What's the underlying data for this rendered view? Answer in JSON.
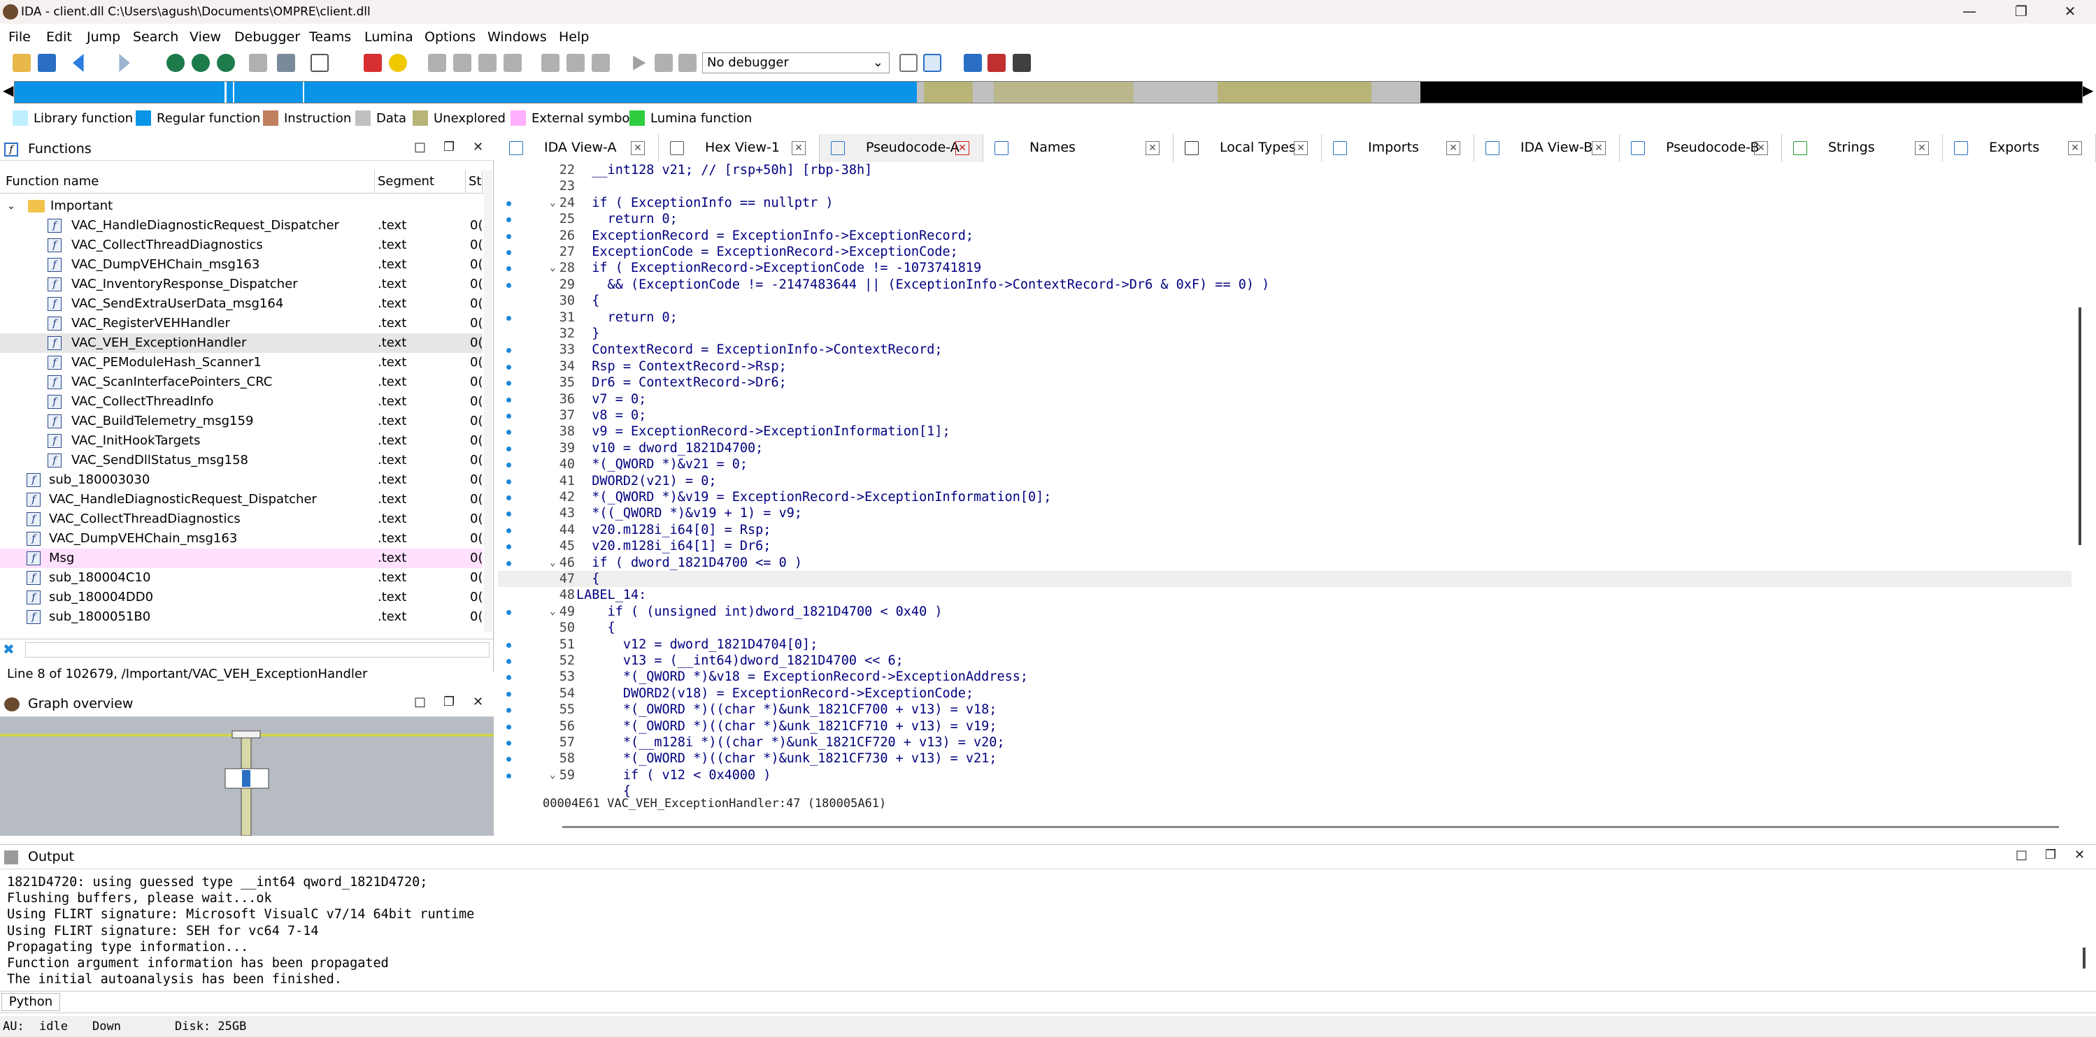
{
  "window": {
    "title": "IDA - client.dll C:\\Users\\agush\\Documents\\OMPRE\\client.dll"
  },
  "menu": [
    "File",
    "Edit",
    "Jump",
    "Search",
    "View",
    "Debugger",
    "Teams",
    "Lumina",
    "Options",
    "Windows",
    "Help"
  ],
  "toolbar": {
    "debugger_select": "No debugger"
  },
  "legend": [
    {
      "label": "Library function",
      "color": "#bfefff"
    },
    {
      "label": "Regular function",
      "color": "#0a94e8"
    },
    {
      "label": "Instruction",
      "color": "#c08060"
    },
    {
      "label": "Data",
      "color": "#c0c0c0"
    },
    {
      "label": "Unexplored",
      "color": "#b8b478"
    },
    {
      "label": "External symbol",
      "color": "#ffb0ff"
    },
    {
      "label": "Lumina function",
      "color": "#30cc40"
    }
  ],
  "functions_panel": {
    "title": "Functions",
    "columns": [
      "Function name",
      "Segment",
      "St"
    ],
    "folder": "Important",
    "rows": [
      {
        "name": "VAC_HandleDiagnosticRequest_Dispatcher",
        "seg": ".text",
        "st": "0("
      },
      {
        "name": "VAC_CollectThreadDiagnostics",
        "seg": ".text",
        "st": "0("
      },
      {
        "name": "VAC_DumpVEHChain_msg163",
        "seg": ".text",
        "st": "0("
      },
      {
        "name": "VAC_InventoryResponse_Dispatcher",
        "seg": ".text",
        "st": "0("
      },
      {
        "name": "VAC_SendExtraUserData_msg164",
        "seg": ".text",
        "st": "0("
      },
      {
        "name": "VAC_RegisterVEHHandler",
        "seg": ".text",
        "st": "0("
      },
      {
        "name": "VAC_VEH_ExceptionHandler",
        "seg": ".text",
        "st": "0("
      },
      {
        "name": "VAC_PEModuleHash_Scanner1",
        "seg": ".text",
        "st": "0("
      },
      {
        "name": "VAC_ScanInterfacePointers_CRC",
        "seg": ".text",
        "st": "0("
      },
      {
        "name": "VAC_CollectThreadInfo",
        "seg": ".text",
        "st": "0("
      },
      {
        "name": "VAC_BuildTelemetry_msg159",
        "seg": ".text",
        "st": "0("
      },
      {
        "name": "VAC_InitHookTargets",
        "seg": ".text",
        "st": "0("
      },
      {
        "name": "VAC_SendDllStatus_msg158",
        "seg": ".text",
        "st": "0("
      },
      {
        "name": "sub_180003030",
        "seg": ".text",
        "st": "0("
      },
      {
        "name": "VAC_HandleDiagnosticRequest_Dispatcher",
        "seg": ".text",
        "st": "0("
      },
      {
        "name": "VAC_CollectThreadDiagnostics",
        "seg": ".text",
        "st": "0("
      },
      {
        "name": "VAC_DumpVEHChain_msg163",
        "seg": ".text",
        "st": "0("
      },
      {
        "name": "Msg",
        "seg": ".text",
        "st": "0("
      },
      {
        "name": "sub_180004C10",
        "seg": ".text",
        "st": "0("
      },
      {
        "name": "sub_180004DD0",
        "seg": ".text",
        "st": "0("
      },
      {
        "name": "sub_1800051B0",
        "seg": ".text",
        "st": "0("
      }
    ],
    "status": "Line 8 of 102679, /Important/VAC_VEH_ExceptionHandler"
  },
  "graph_overview": {
    "title": "Graph overview"
  },
  "tabs": [
    "IDA View-A",
    "Hex View-1",
    "Pseudocode-A",
    "Names",
    "Local Types",
    "Imports",
    "IDA View-B",
    "Pseudocode-B",
    "Strings",
    "Exports"
  ],
  "code_lines": [
    {
      "n": "22",
      "t": "  __int128 v21; // [rsp+50h] [rbp-38h]"
    },
    {
      "n": "23",
      "t": ""
    },
    {
      "n": "24",
      "t": "  if ( ExceptionInfo == nullptr )"
    },
    {
      "n": "25",
      "t": "    return 0;"
    },
    {
      "n": "26",
      "t": "  ExceptionRecord = ExceptionInfo->ExceptionRecord;"
    },
    {
      "n": "27",
      "t": "  ExceptionCode = ExceptionRecord->ExceptionCode;"
    },
    {
      "n": "28",
      "t": "  if ( ExceptionRecord->ExceptionCode != -1073741819"
    },
    {
      "n": "29",
      "t": "    && (ExceptionCode != -2147483644 || (ExceptionInfo->ContextRecord->Dr6 & 0xF) == 0) )"
    },
    {
      "n": "30",
      "t": "  {"
    },
    {
      "n": "31",
      "t": "    return 0;"
    },
    {
      "n": "32",
      "t": "  }"
    },
    {
      "n": "33",
      "t": "  ContextRecord = ExceptionInfo->ContextRecord;"
    },
    {
      "n": "34",
      "t": "  Rsp = ContextRecord->Rsp;"
    },
    {
      "n": "35",
      "t": "  Dr6 = ContextRecord->Dr6;"
    },
    {
      "n": "36",
      "t": "  v7 = 0;"
    },
    {
      "n": "37",
      "t": "  v8 = 0;"
    },
    {
      "n": "38",
      "t": "  v9 = ExceptionRecord->ExceptionInformation[1];"
    },
    {
      "n": "39",
      "t": "  v10 = dword_1821D4700;"
    },
    {
      "n": "40",
      "t": "  *(_QWORD *)&v21 = 0;"
    },
    {
      "n": "41",
      "t": "  DWORD2(v21) = 0;"
    },
    {
      "n": "42",
      "t": "  *(_QWORD *)&v19 = ExceptionRecord->ExceptionInformation[0];"
    },
    {
      "n": "43",
      "t": "  *((_QWORD *)&v19 + 1) = v9;"
    },
    {
      "n": "44",
      "t": "  v20.m128i_i64[0] = Rsp;"
    },
    {
      "n": "45",
      "t": "  v20.m128i_i64[1] = Dr6;"
    },
    {
      "n": "46",
      "t": "  if ( dword_1821D4700 <= 0 )"
    },
    {
      "n": "47",
      "t": "  {"
    },
    {
      "n": "48",
      "t": "LABEL_14:"
    },
    {
      "n": "49",
      "t": "    if ( (unsigned int)dword_1821D4700 < 0x40 )"
    },
    {
      "n": "50",
      "t": "    {"
    },
    {
      "n": "51",
      "t": "      v12 = dword_1821D4704[0];"
    },
    {
      "n": "52",
      "t": "      v13 = (__int64)dword_1821D4700 << 6;"
    },
    {
      "n": "53",
      "t": "      *(_QWORD *)&v18 = ExceptionRecord->ExceptionAddress;"
    },
    {
      "n": "54",
      "t": "      DWORD2(v18) = ExceptionRecord->ExceptionCode;"
    },
    {
      "n": "55",
      "t": "      *(_OWORD *)((char *)&unk_1821CF700 + v13) = v18;"
    },
    {
      "n": "56",
      "t": "      *(_OWORD *)((char *)&unk_1821CF710 + v13) = v19;"
    },
    {
      "n": "57",
      "t": "      *(__m128i *)((char *)&unk_1821CF720 + v13) = v20;"
    },
    {
      "n": "58",
      "t": "      *(_OWORD *)((char *)&unk_1821CF730 + v13) = v21;"
    },
    {
      "n": "59",
      "t": "      if ( v12 < 0x4000 )"
    },
    {
      "n": "",
      "t": "      {"
    }
  ],
  "code_status": "00004E61 VAC_VEH_ExceptionHandler:47 (180005A61)",
  "output": {
    "title": "Output",
    "lines": [
      "1821D4720: using guessed type __int64 qword_1821D4720;",
      "Flushing buffers, please wait...ok",
      "Using FLIRT signature: Microsoft VisualC v7/14 64bit runtime",
      "Using FLIRT signature: SEH for vc64 7-14",
      "Propagating type information...",
      "Function argument information has been propagated",
      "The initial autoanalysis has been finished."
    ]
  },
  "python_button": "Python",
  "status_bar": {
    "au": "AU:",
    "state": "idle",
    "dir": "Down",
    "disk": "Disk: 25GB"
  }
}
